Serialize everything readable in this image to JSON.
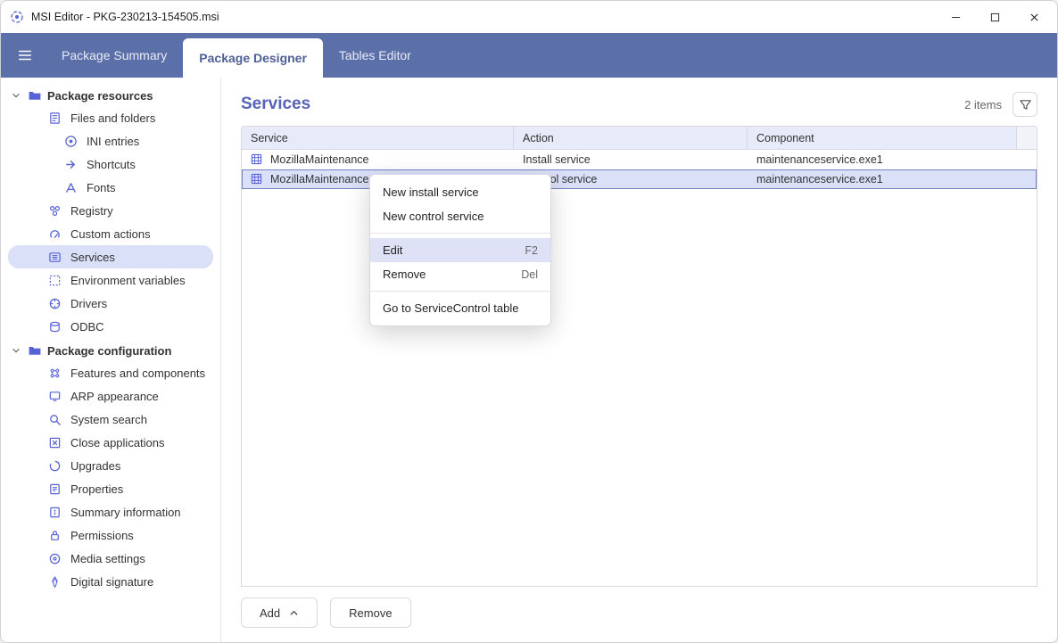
{
  "window": {
    "app_name": "MSI Editor",
    "file_name": "PKG-230213-154505.msi",
    "title": "MSI Editor - PKG-230213-154505.msi"
  },
  "tabs": {
    "summary": "Package Summary",
    "designer": "Package Designer",
    "tables": "Tables Editor",
    "active": "designer"
  },
  "sidebar": {
    "groups": [
      {
        "label": "Package resources",
        "items": [
          {
            "id": "files",
            "label": "Files and folders",
            "icon": "file-icon",
            "children": [
              {
                "id": "ini",
                "label": "INI entries",
                "icon": "ini-icon"
              }
            ]
          },
          {
            "id": "shortcuts",
            "label": "Shortcuts",
            "icon": "shortcut-icon"
          },
          {
            "id": "fonts",
            "label": "Fonts",
            "icon": "font-icon"
          },
          {
            "id": "registry",
            "label": "Registry",
            "icon": "registry-icon"
          },
          {
            "id": "custom",
            "label": "Custom actions",
            "icon": "custom-icon"
          },
          {
            "id": "services",
            "label": "Services",
            "icon": "services-icon",
            "selected": true
          },
          {
            "id": "env",
            "label": "Environment variables",
            "icon": "env-icon"
          },
          {
            "id": "drivers",
            "label": "Drivers",
            "icon": "drivers-icon"
          },
          {
            "id": "odbc",
            "label": "ODBC",
            "icon": "odbc-icon"
          }
        ]
      },
      {
        "label": "Package configuration",
        "items": [
          {
            "id": "features",
            "label": "Features and components",
            "icon": "features-icon"
          },
          {
            "id": "arp",
            "label": "ARP appearance",
            "icon": "arp-icon"
          },
          {
            "id": "search",
            "label": "System search",
            "icon": "search-icon"
          },
          {
            "id": "closeapp",
            "label": "Close applications",
            "icon": "close-apps-icon"
          },
          {
            "id": "upgrades",
            "label": "Upgrades",
            "icon": "upgrades-icon"
          },
          {
            "id": "props",
            "label": "Properties",
            "icon": "properties-icon"
          },
          {
            "id": "summary",
            "label": "Summary information",
            "icon": "summary-icon"
          },
          {
            "id": "perms",
            "label": "Permissions",
            "icon": "permissions-icon"
          },
          {
            "id": "media",
            "label": "Media settings",
            "icon": "media-icon"
          },
          {
            "id": "digsig",
            "label": "Digital signature",
            "icon": "signature-icon"
          }
        ]
      }
    ]
  },
  "main": {
    "title": "Services",
    "item_count_label": "2 items",
    "columns": {
      "service": "Service",
      "action": "Action",
      "component": "Component"
    },
    "rows": [
      {
        "service": "MozillaMaintenance",
        "action": "Install service",
        "component": "maintenanceservice.exe1",
        "selected": false
      },
      {
        "service": "MozillaMaintenance",
        "action": "Control service",
        "component": "maintenanceservice.exe1",
        "selected": true
      }
    ],
    "footer": {
      "add": "Add",
      "remove": "Remove"
    }
  },
  "context_menu": {
    "items": [
      {
        "label": "New install service",
        "shortcut": ""
      },
      {
        "label": "New control service",
        "shortcut": ""
      },
      {
        "sep": true
      },
      {
        "label": "Edit",
        "shortcut": "F2",
        "hover": true
      },
      {
        "label": "Remove",
        "shortcut": "Del"
      },
      {
        "sep": true
      },
      {
        "label": "Go to ServiceControl table",
        "shortcut": ""
      }
    ]
  }
}
